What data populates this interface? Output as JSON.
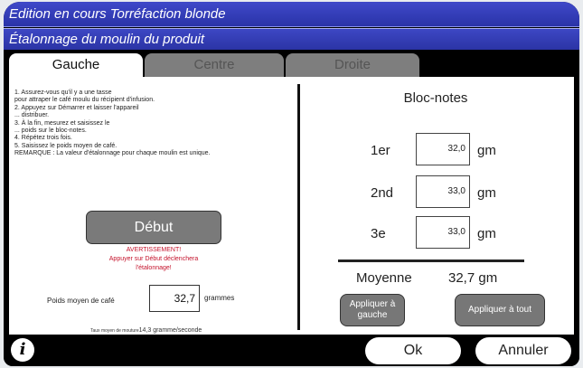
{
  "header": {
    "title": "Edition en cours Torréfaction blonde",
    "subtitle": "Étalonnage du moulin du produit"
  },
  "tabs": [
    {
      "label": "Gauche",
      "active": true
    },
    {
      "label": "Centre",
      "active": false
    },
    {
      "label": "Droite",
      "active": false
    }
  ],
  "instructions": [
    "1. Assurez-vous qu'il y a une tasse",
    "    pour attraper le café moulu du récipient d'infusion.",
    "2. Appuyez sur Démarrer et laisser l'appareil",
    "... distribuer.",
    "3. À la fin, mesurez et saisissez le",
    "... poids sur le bloc-notes.",
    "4. Répétez trois fois.",
    "5. Saisissez le poids moyen de café.",
    "    REMARQUE : La valeur d'étalonnage pour chaque moulin est unique."
  ],
  "start_button": "Début",
  "warning": {
    "title": "AVERTISSEMENT!",
    "line1": "Appuyer sur Début déclenchera",
    "line2": "l'étalonnage!"
  },
  "average": {
    "label": "Poids moyen de café",
    "value": "32,7",
    "unit": "grammes"
  },
  "rate": {
    "label": "Taux moyen de mouture",
    "value": "14,3 gramme/seconde"
  },
  "notepad": {
    "title": "Bloc-notes",
    "rows": [
      {
        "label": "1er",
        "value": "32,0",
        "unit": "gm"
      },
      {
        "label": "2nd",
        "value": "33,0",
        "unit": "gm"
      },
      {
        "label": "3e",
        "value": "33,0",
        "unit": "gm"
      }
    ],
    "average_label": "Moyenne",
    "average_value": "32,7 gm"
  },
  "actions": {
    "apply_left": "Appliquer à gauche",
    "apply_all": "Appliquer à tout",
    "ok": "Ok",
    "cancel": "Annuler"
  },
  "icons": {
    "info": "info-icon"
  },
  "colors": {
    "header": "#2f38b0",
    "warning": "#c4122b",
    "button_gray": "#7a7a7a"
  }
}
